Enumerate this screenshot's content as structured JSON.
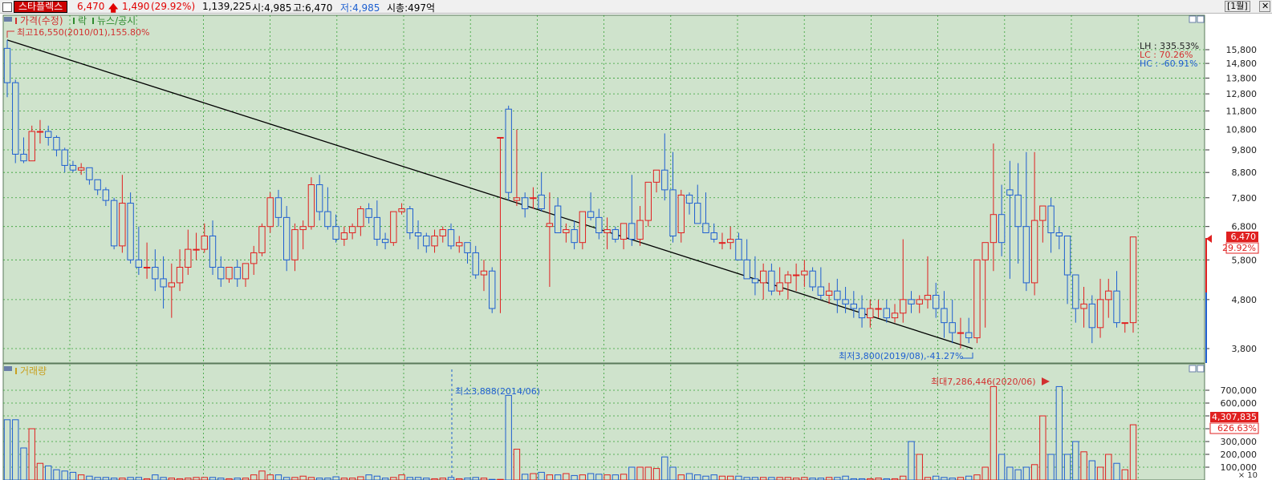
{
  "header": {
    "stock_name": "스타플렉스",
    "price": "6,470",
    "change": "1,490",
    "change_pct": "(29.92%)",
    "volume": "1,139,225",
    "open": "시:4,985",
    "high": "고:6,470",
    "low": "저:4,985",
    "market_cap": "시총:497억",
    "period_button": "[1월]",
    "close_button": "✕"
  },
  "price_panel": {
    "legend": {
      "price": "가격(수정)",
      "down": "락",
      "news": "뉴스/공시"
    },
    "high_annotation": "최고16,550(2010/01),155.80%",
    "low_annotation": "최저3,800(2019/08),-41.27%",
    "stats": {
      "lh": "LH : 335.53%",
      "lc": "LC : 70.26%",
      "hc": "HC : -60.91%"
    },
    "price_badge": "6,470",
    "pct_badge": "29.92%",
    "y_ticks": [
      "15,800",
      "14,800",
      "13,800",
      "12,800",
      "11,800",
      "10,800",
      "9,800",
      "8,800",
      "7,800",
      "6,800",
      "5,800",
      "4,800",
      "3,800"
    ]
  },
  "volume_panel": {
    "legend": "거래량",
    "min_annotation": "최소3,888(2014/06)",
    "max_annotation": "최대7,286,446(2020/06)",
    "volume_badge": "4,307,835",
    "pct_badge": "626.63%",
    "y_ticks": [
      "700,000",
      "600,000",
      "500,000",
      "400,000",
      "300,000",
      "200,000",
      "100,000"
    ],
    "unit": "× 10"
  },
  "colors": {
    "up": "#e02020",
    "down": "#1f5fd0",
    "background": "#cfe3cc",
    "grid": "#33a033"
  },
  "chart_data": {
    "type": "candlestick",
    "interval": "monthly",
    "open": [
      15900,
      13500,
      9600,
      9300,
      10700,
      10700,
      10400,
      9800,
      9100,
      8900,
      9000,
      8500,
      8100,
      7700,
      6200,
      7600,
      5800,
      5600,
      5600,
      5300,
      5100,
      5200,
      5600,
      6100,
      6100,
      6500,
      5600,
      5300,
      5600,
      5300,
      5700,
      6000,
      6800,
      7800,
      7100,
      5800,
      6700,
      6800,
      8300,
      7300,
      6800,
      6400,
      6600,
      6800,
      7400,
      7100,
      6400,
      6300,
      7300,
      7400,
      6600,
      6500,
      6200,
      6500,
      6700,
      6200,
      6300,
      6000,
      5400,
      5500,
      10400,
      11900,
      7700,
      7800,
      7800,
      7900,
      6800,
      7500,
      6600,
      6700,
      6300,
      7300,
      7100,
      6600,
      6700,
      6400,
      6900,
      6400,
      7000,
      8400,
      8900,
      8100,
      6600,
      7900,
      7600,
      6900,
      6600,
      6300,
      6300,
      6400,
      5800,
      5300,
      5200,
      5500,
      5000,
      5200,
      5400,
      5400,
      5500,
      5100,
      4900,
      5000,
      4800,
      4700,
      4600,
      4400,
      4600,
      4600,
      4400,
      4500,
      4800,
      4700,
      4800,
      4900,
      4600,
      4300,
      4100,
      4100,
      4000,
      5800,
      6300,
      7200,
      8100,
      7900,
      6800,
      5200,
      7000,
      7500,
      6600,
      6500,
      5400,
      4600,
      4700,
      4200,
      4800,
      5000,
      4300,
      4300
    ],
    "close": [
      13500,
      9600,
      9300,
      10700,
      10700,
      10400,
      9800,
      9100,
      8900,
      9000,
      8500,
      8100,
      7700,
      6200,
      7600,
      5800,
      5600,
      5600,
      5300,
      5100,
      5200,
      5600,
      6100,
      6100,
      6500,
      5600,
      5300,
      5600,
      5300,
      5700,
      6000,
      6800,
      7800,
      7100,
      5800,
      6700,
      6800,
      8300,
      7300,
      6800,
      6400,
      6600,
      6800,
      7400,
      7100,
      6400,
      6300,
      7300,
      7400,
      6600,
      6500,
      6200,
      6500,
      6700,
      6200,
      6300,
      6000,
      5400,
      5500,
      4600,
      10400,
      8000,
      7800,
      7400,
      7800,
      7400,
      6900,
      6600,
      6700,
      6300,
      7300,
      7100,
      6600,
      6700,
      6400,
      6900,
      6400,
      7000,
      8400,
      8900,
      8100,
      6500,
      7900,
      7600,
      6900,
      6600,
      6400,
      6300,
      6400,
      5800,
      5300,
      5200,
      5500,
      5000,
      5200,
      5400,
      5400,
      5500,
      5100,
      4900,
      5000,
      4800,
      4700,
      4600,
      4400,
      4600,
      4600,
      4400,
      4500,
      4800,
      4700,
      4800,
      4900,
      4600,
      4300,
      4100,
      4100,
      4000,
      5800,
      6300,
      7200,
      6300,
      7900,
      6800,
      5200,
      7000,
      7500,
      6600,
      6500,
      5400,
      4600,
      4700,
      4200,
      4800,
      5000,
      4300,
      4300,
      6470
    ],
    "high": [
      16550,
      13700,
      10400,
      11000,
      11300,
      11000,
      10500,
      9900,
      9300,
      9200,
      8900,
      8400,
      8200,
      7800,
      8700,
      8000,
      6800,
      6300,
      6100,
      5900,
      5700,
      6100,
      6700,
      6600,
      6900,
      7000,
      5900,
      5600,
      5800,
      5700,
      6200,
      6900,
      8000,
      8100,
      7500,
      6900,
      7000,
      8600,
      8700,
      8200,
      7200,
      6800,
      6900,
      7500,
      7600,
      7700,
      6600,
      7300,
      7600,
      7500,
      7000,
      6600,
      6700,
      6800,
      6900,
      6500,
      6300,
      6200,
      5800,
      5600,
      10400,
      12100,
      10800,
      8000,
      8200,
      8800,
      8000,
      7800,
      6900,
      7000,
      7300,
      8000,
      7400,
      7100,
      6800,
      6900,
      8700,
      7500,
      7700,
      8800,
      10600,
      9700,
      8100,
      8000,
      8300,
      8000,
      6900,
      6600,
      6800,
      6600,
      6400,
      5900,
      5700,
      5700,
      5600,
      5500,
      5700,
      5800,
      5600,
      5600,
      5200,
      5300,
      5100,
      5000,
      4900,
      4800,
      4800,
      4800,
      4700,
      6400,
      5000,
      4900,
      5900,
      5200,
      5000,
      4800,
      4400,
      4400,
      5200,
      5800,
      10100,
      8300,
      9300,
      9200,
      9700,
      9700,
      7200,
      7800,
      6800,
      5800,
      4900,
      5100,
      4900,
      5300,
      5300,
      5500,
      4300,
      6470
    ],
    "low": [
      12600,
      9200,
      9200,
      9300,
      10100,
      10000,
      9500,
      8800,
      8800,
      8700,
      8300,
      7900,
      7500,
      6100,
      6000,
      5700,
      5400,
      5300,
      5000,
      4600,
      4400,
      5000,
      5400,
      5800,
      6000,
      5400,
      5100,
      5200,
      5100,
      5100,
      5400,
      5900,
      6600,
      6800,
      5500,
      5500,
      6100,
      6700,
      7000,
      6700,
      6300,
      6200,
      6400,
      6500,
      6900,
      6200,
      6100,
      6200,
      7200,
      6400,
      6100,
      6000,
      6000,
      6300,
      6100,
      6000,
      5700,
      5300,
      5000,
      4500,
      4500,
      7700,
      7500,
      7100,
      7400,
      7300,
      5100,
      6600,
      6300,
      6100,
      6100,
      7000,
      6400,
      6100,
      6300,
      6100,
      6200,
      6200,
      6800,
      8000,
      7700,
      6300,
      6300,
      7200,
      7000,
      6700,
      6300,
      6100,
      6100,
      5900,
      5300,
      4900,
      4800,
      4900,
      4900,
      4800,
      5000,
      5100,
      5000,
      4800,
      4700,
      4500,
      4500,
      4400,
      4200,
      4200,
      4400,
      4300,
      4300,
      4300,
      4500,
      4500,
      4600,
      4400,
      4000,
      3900,
      3800,
      3900,
      3900,
      4200,
      5500,
      5900,
      5300,
      5700,
      5000,
      4900,
      6300,
      6000,
      6100,
      4700,
      4300,
      4200,
      3900,
      4000,
      4400,
      4200,
      4100,
      4100
    ],
    "volume": [
      470000,
      470000,
      250000,
      400000,
      130000,
      110000,
      80000,
      70000,
      60000,
      40000,
      30000,
      20000,
      20000,
      15000,
      15000,
      20000,
      20000,
      10000,
      40000,
      20000,
      15000,
      10000,
      15000,
      20000,
      20000,
      20000,
      15000,
      10000,
      15000,
      15000,
      40000,
      70000,
      40000,
      40000,
      20000,
      20000,
      30000,
      20000,
      15000,
      15000,
      25000,
      15000,
      15000,
      25000,
      40000,
      30000,
      15000,
      20000,
      40000,
      20000,
      20000,
      15000,
      10000,
      15000,
      20000,
      10000,
      15000,
      20000,
      15000,
      5000,
      5000,
      660000,
      240000,
      45000,
      50000,
      60000,
      40000,
      40000,
      50000,
      35000,
      40000,
      50000,
      45000,
      40000,
      40000,
      45000,
      100000,
      100000,
      100000,
      90000,
      180000,
      100000,
      40000,
      50000,
      40000,
      30000,
      40000,
      30000,
      30000,
      30000,
      20000,
      20000,
      20000,
      20000,
      20000,
      20000,
      15000,
      20000,
      15000,
      15000,
      20000,
      20000,
      30000,
      10000,
      10000,
      10000,
      15000,
      10000,
      10000,
      30000,
      300000,
      200000,
      20000,
      30000,
      20000,
      15000,
      20000,
      30000,
      40000,
      100000,
      728644,
      200000,
      100000,
      80000,
      100000,
      120000,
      500000,
      200000,
      728644,
      200000,
      300000,
      220000,
      150000,
      100000,
      200000,
      130000,
      80000,
      430783
    ],
    "trendline": {
      "start_price": 16550,
      "end_price": 3800
    },
    "price_range": [
      3400,
      16800
    ],
    "volume_range": [
      0,
      780000
    ]
  }
}
